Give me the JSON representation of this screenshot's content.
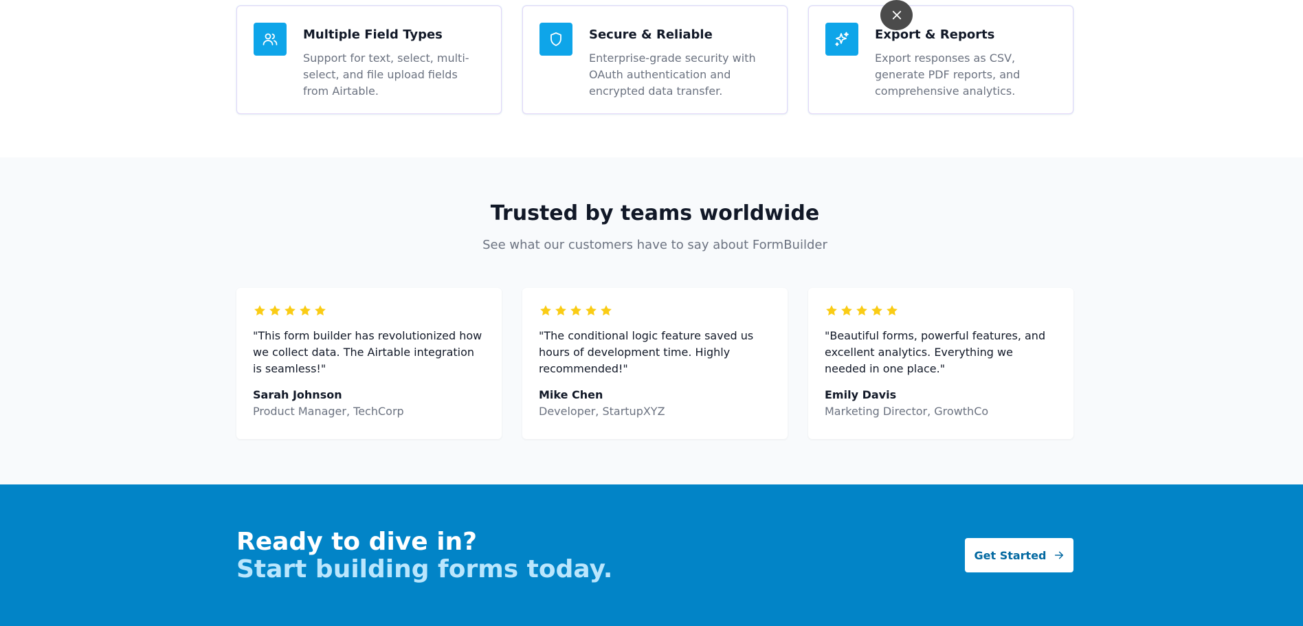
{
  "features": [
    {
      "icon": "users-icon",
      "title": "Multiple Field Types",
      "description": "Support for text, select, multi-select, and file upload fields from Airtable."
    },
    {
      "icon": "shield-icon",
      "title": "Secure & Reliable",
      "description": "Enterprise-grade security with OAuth authentication and encrypted data transfer."
    },
    {
      "icon": "sparkles-icon",
      "title": "Export & Reports",
      "description": "Export responses as CSV, generate PDF reports, and comprehensive analytics."
    }
  ],
  "overlay": {
    "close_icon": "close-icon"
  },
  "testimonials": {
    "heading": "Trusted by teams worldwide",
    "subheading": "See what our customers have to say about FormBuilder",
    "items": [
      {
        "rating": 5,
        "quote": "\"This form builder has revolutionized how we collect data. The Airtable integration is seamless!\"",
        "author": "Sarah Johnson",
        "role": "Product Manager, TechCorp"
      },
      {
        "rating": 5,
        "quote": "\"The conditional logic feature saved us hours of development time. Highly recommended!\"",
        "author": "Mike Chen",
        "role": "Developer, StartupXYZ"
      },
      {
        "rating": 5,
        "quote": "\"Beautiful forms, powerful features, and excellent analytics. Everything we needed in one place.\"",
        "author": "Emily Davis",
        "role": "Marketing Director, GrowthCo"
      }
    ]
  },
  "cta": {
    "line1": "Ready to dive in?",
    "line2": "Start building forms today.",
    "button_label": "Get Started",
    "button_icon": "arrow-right-icon"
  },
  "colors": {
    "accent": "#0ea5e9",
    "cta_background": "#0284c7",
    "cta_subline": "#bae6fd",
    "star": "#facc15"
  }
}
